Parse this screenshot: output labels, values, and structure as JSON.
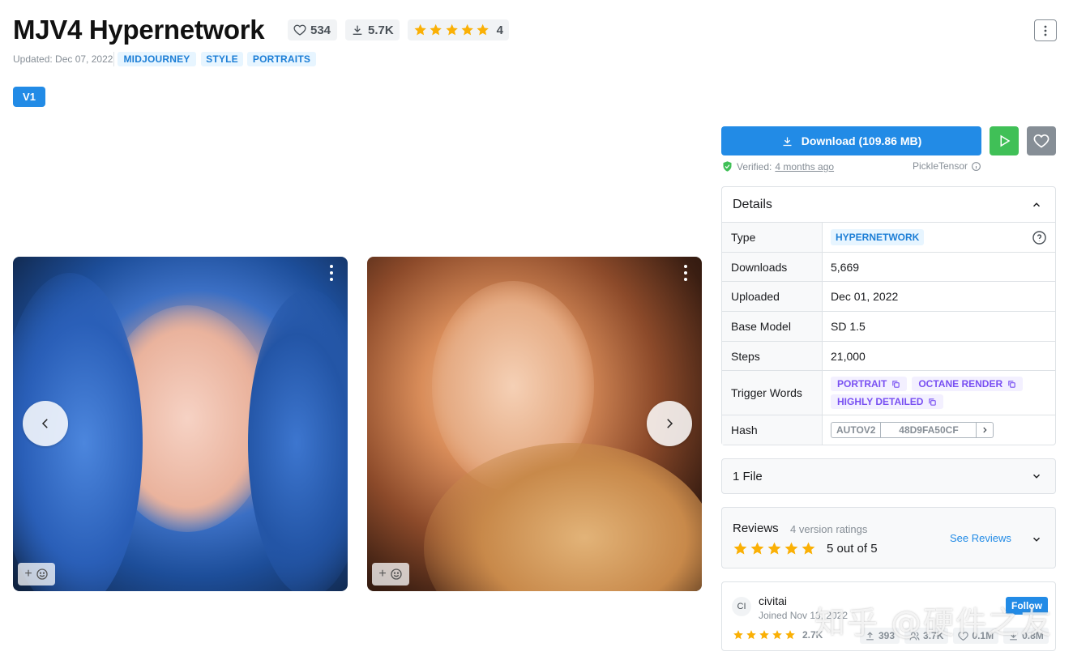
{
  "model": {
    "title": "MJV4 Hypernetwork",
    "likes": "534",
    "downloads_short": "5.7K",
    "rating_count": "4",
    "updated": "Updated: Dec 07, 2022",
    "tags": [
      "MIDJOURNEY",
      "STYLE",
      "PORTRAITS"
    ],
    "version": "V1"
  },
  "actions": {
    "download_label": "Download (109.86 MB)",
    "verified_label": "Verified:",
    "verified_time": "4 months ago",
    "pickle": "PickleTensor"
  },
  "details": {
    "header": "Details",
    "rows": [
      {
        "label": "Type",
        "value": "HYPERNETWORK"
      },
      {
        "label": "Downloads",
        "value": "5,669"
      },
      {
        "label": "Uploaded",
        "value": "Dec 01, 2022"
      },
      {
        "label": "Base Model",
        "value": "SD 1.5"
      },
      {
        "label": "Steps",
        "value": "21,000"
      },
      {
        "label": "Trigger Words",
        "value": ""
      },
      {
        "label": "Hash",
        "value": ""
      }
    ],
    "trigger_words": [
      "PORTRAIT",
      "OCTANE RENDER",
      "HIGHLY DETAILED"
    ],
    "hash_type": "AUTOV2",
    "hash_value": "48D9FA50CF"
  },
  "files": {
    "label": "1 File"
  },
  "reviews": {
    "title": "Reviews",
    "sub": "4 version ratings",
    "score": "5 out of 5",
    "see_reviews": "See Reviews"
  },
  "creator": {
    "initials": "CI",
    "name": "civitai",
    "joined": "Joined Nov 13, 2022",
    "follow": "Follow",
    "rating_count": "2.7K",
    "uploads": "393",
    "followers": "3.7K",
    "likes": "0.1M",
    "downloads": "0.8M"
  },
  "watermark": "知乎 @硬件之友",
  "colors": {
    "accent": "#228be6",
    "run": "#40c057",
    "star": "#fab005",
    "trigger": "#7950f2"
  },
  "icons": [
    "heart-icon",
    "download-icon",
    "star-icon",
    "more-vertical-icon",
    "play-icon",
    "shield-check-icon",
    "info-icon",
    "chevron-up-icon",
    "chevron-down-icon",
    "chevron-left-icon",
    "chevron-right-icon",
    "copy-icon",
    "help-icon",
    "upload-icon",
    "users-icon",
    "add-reaction-icon"
  ]
}
